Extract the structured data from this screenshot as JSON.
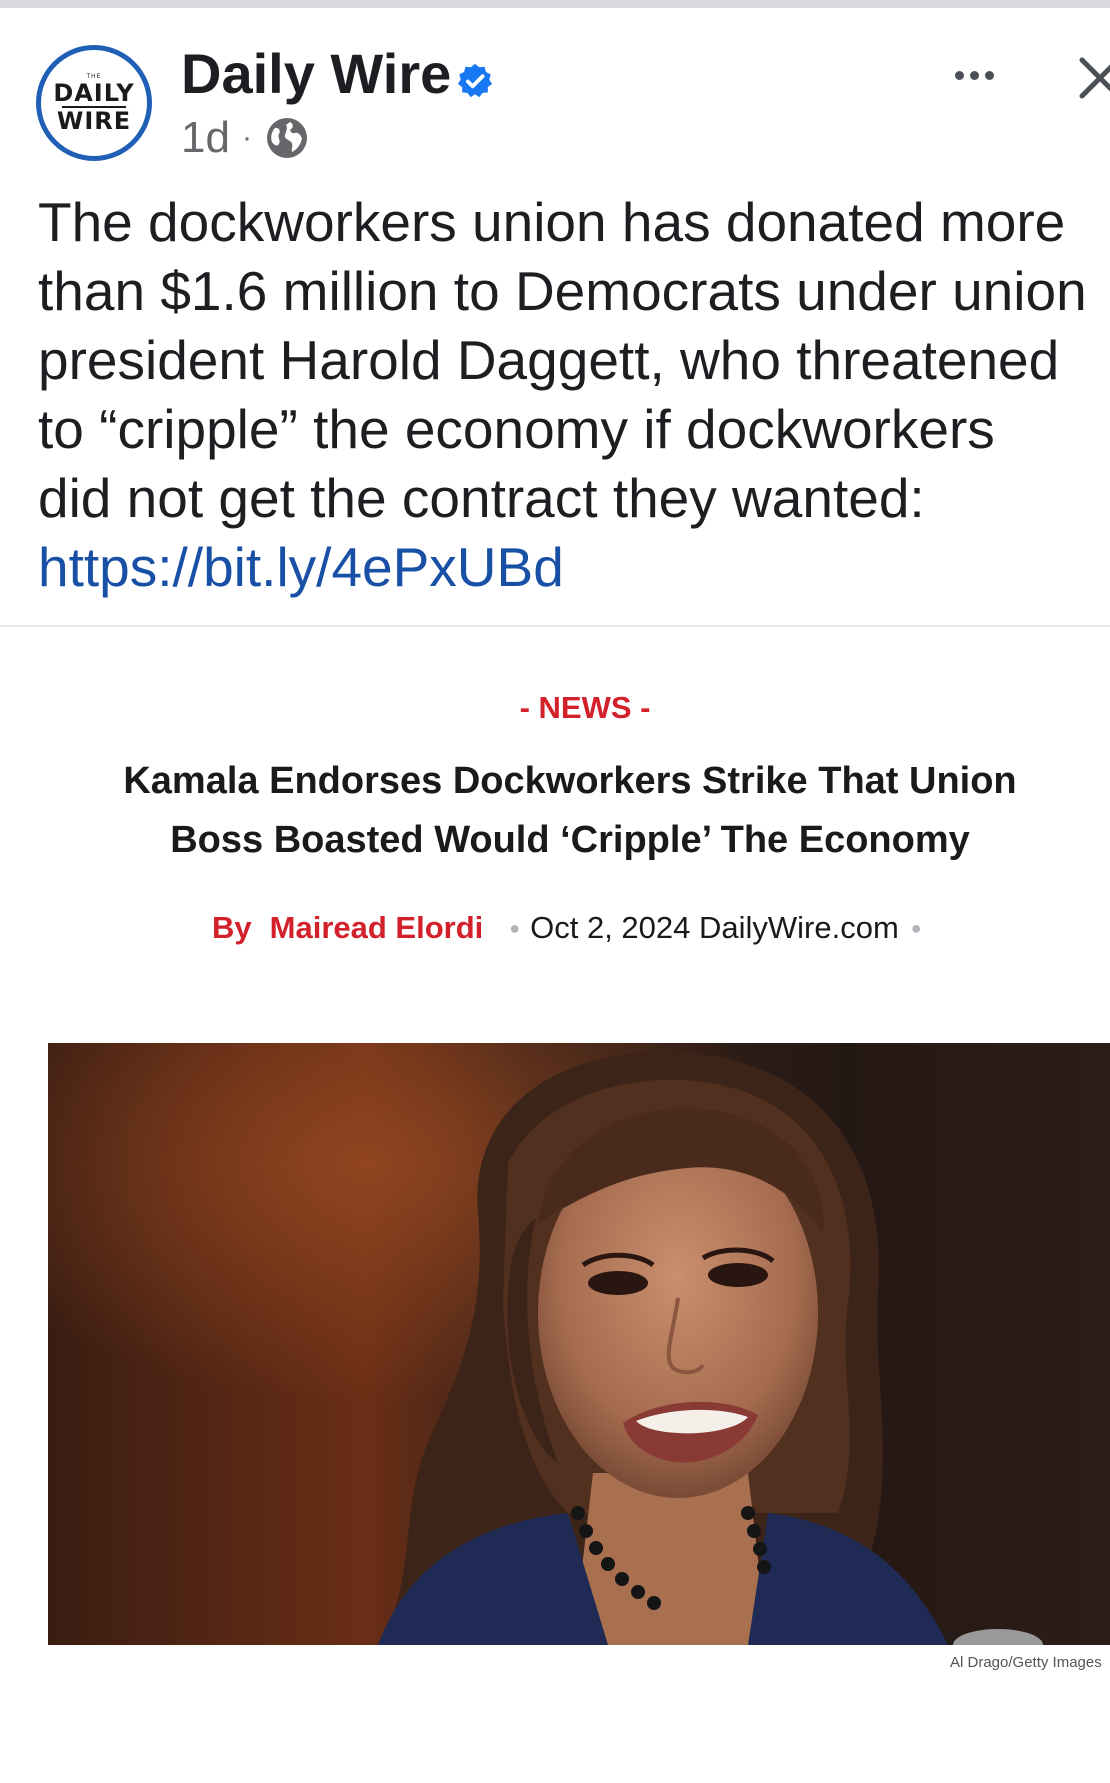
{
  "post": {
    "page_name": "Daily Wire",
    "avatar_logo": {
      "small": "THE",
      "line1": "DAILY",
      "line2": "WIRE"
    },
    "time": "1d",
    "separator": "·",
    "text_lines": [
      "The dockworkers union has donated more",
      "than $1.6 million to Democrats under union",
      "president Harold Daggett, who threatened",
      "to “cripple” the economy if dockworkers",
      "did not get the contract they wanted:"
    ],
    "link": "https://bit.ly/4ePxUBd",
    "icons": [
      "verified-badge-icon",
      "globe-icon",
      "more-icon",
      "close-icon"
    ]
  },
  "article": {
    "section": "- NEWS -",
    "title_lines": [
      "Kamala Endorses Dockworkers Strike That Union",
      "Boss Boasted Would ‘Cripple’ The Economy"
    ],
    "by": "By",
    "author": "Mairead Elordi",
    "date_source": "Oct 2, 2024 DailyWire.com",
    "photo_credit": "Al Drago/Getty Images"
  },
  "colors": {
    "verified": "#1877f2",
    "link": "#1850a6",
    "accent_red": "#d3212c",
    "avatar_ring": "#1f5fb6",
    "meta_gray": "#65676b"
  }
}
